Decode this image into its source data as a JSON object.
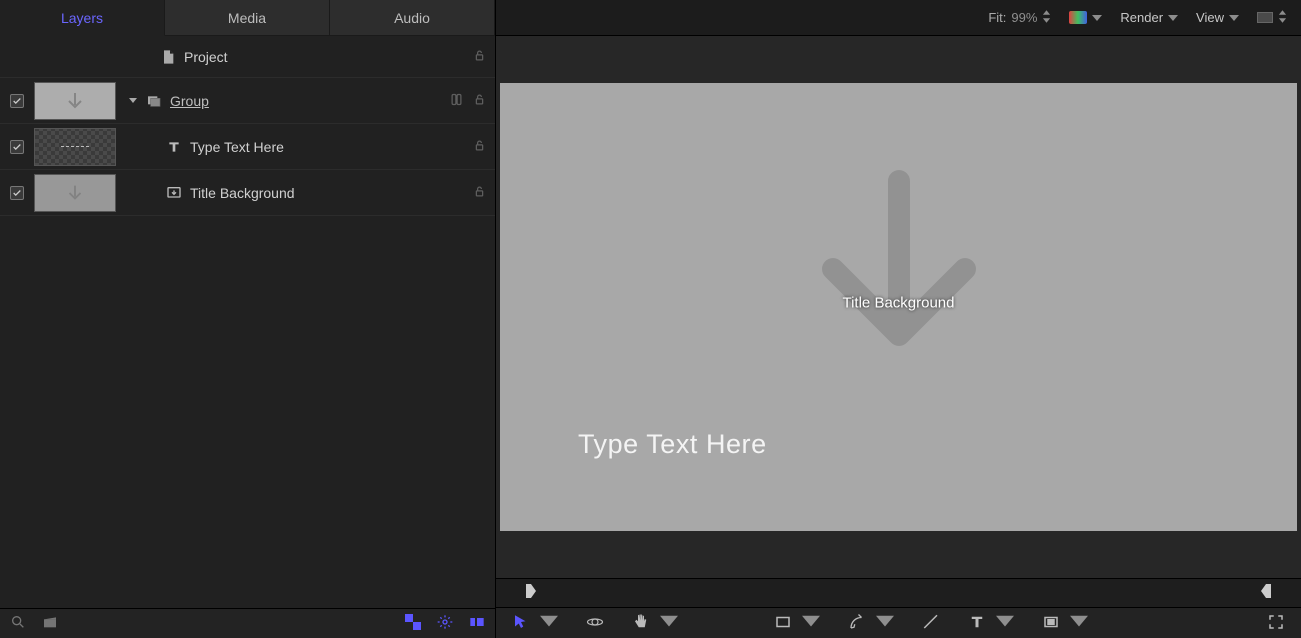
{
  "tabs": {
    "layers": "Layers",
    "media": "Media",
    "audio": "Audio"
  },
  "layers": {
    "project": {
      "label": "Project"
    },
    "group": {
      "label": "Group"
    },
    "text": {
      "label": "Type Text Here"
    },
    "titlebg": {
      "label": "Title Background"
    }
  },
  "viewerToolbar": {
    "fit_label": "Fit:",
    "fit_pct": "99%",
    "render": "Render",
    "view": "View"
  },
  "canvas": {
    "center_label": "Title Background",
    "main_text": "Type Text Here"
  }
}
